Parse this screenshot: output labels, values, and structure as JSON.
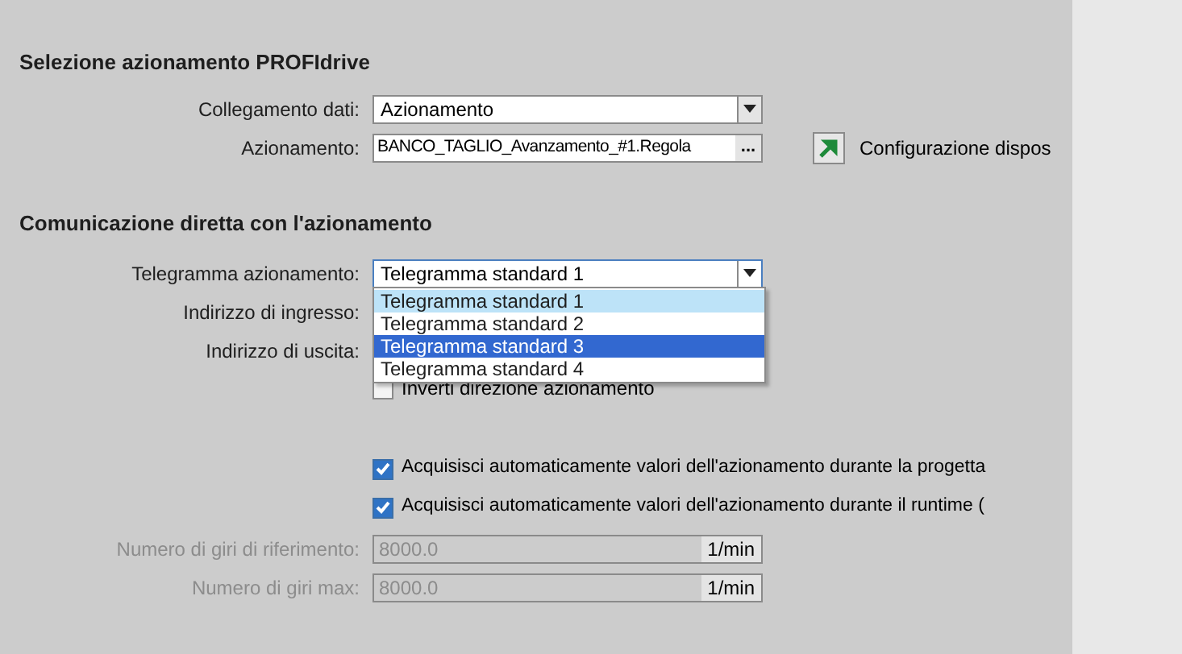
{
  "section_1": {
    "title": "Selezione azionamento PROFIdrive",
    "data_link": {
      "label": "Collegamento dati:",
      "value": "Azionamento"
    },
    "drive": {
      "label": "Azionamento:",
      "value": "BANCO_TAGLIO_Avanzamento_#1.Regola",
      "browse": "...",
      "link": "Configurazione dispos"
    }
  },
  "section_2": {
    "title": "Comunicazione diretta con l'azionamento",
    "telegram": {
      "label": "Telegramma azionamento:",
      "value": "Telegramma standard 1",
      "expanded": true,
      "options": [
        {
          "label": "Telegramma standard 1",
          "selected": true,
          "highlighted": false
        },
        {
          "label": "Telegramma standard 2",
          "selected": false,
          "highlighted": false
        },
        {
          "label": "Telegramma standard 3",
          "selected": false,
          "highlighted": true
        },
        {
          "label": "Telegramma standard 4",
          "selected": false,
          "highlighted": false
        }
      ]
    },
    "input_address": {
      "label": "Indirizzo di ingresso:"
    },
    "output_address": {
      "label": "Indirizzo di uscita:"
    },
    "invert": {
      "label": "Inverti direzione azionamento",
      "checked": false
    },
    "auto_options": [
      {
        "label": "Acquisisci automaticamente valori dell'azionamento durante la progetta",
        "checked": true
      },
      {
        "label": "Acquisisci automaticamente valori dell'azionamento durante il runtime (",
        "checked": true
      }
    ],
    "speeds": [
      {
        "label": "Numero di giri di riferimento:",
        "value": "8000.0",
        "unit": "1/min",
        "disabled": true
      },
      {
        "label": "Numero di giri max:",
        "value": "8000.0",
        "unit": "1/min",
        "disabled": true
      }
    ]
  }
}
